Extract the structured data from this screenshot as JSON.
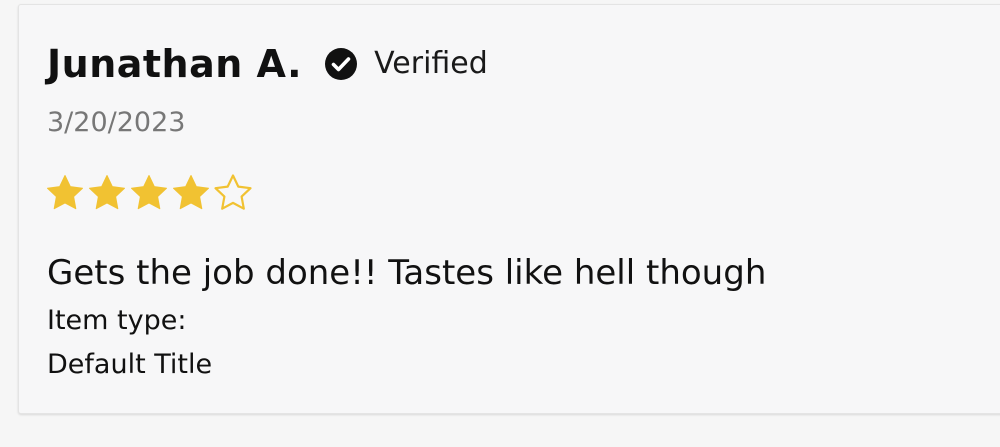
{
  "review": {
    "reviewer_name": "Junathan A.",
    "verified_label": "Verified",
    "date": "3/20/2023",
    "rating": 4,
    "rating_max": 5,
    "body": "Gets the job done!! Tastes like hell though",
    "item_type_label": "Item type:",
    "item_type_value": "Default Title"
  },
  "colors": {
    "star_filled": "#f1c232",
    "star_outline": "#f1c232",
    "verified_badge": "#111111",
    "text_primary": "#111111",
    "text_muted": "#777777"
  },
  "icons": {
    "verified": "check-circle-icon",
    "star_filled": "star-filled-icon",
    "star_empty": "star-outline-icon"
  }
}
